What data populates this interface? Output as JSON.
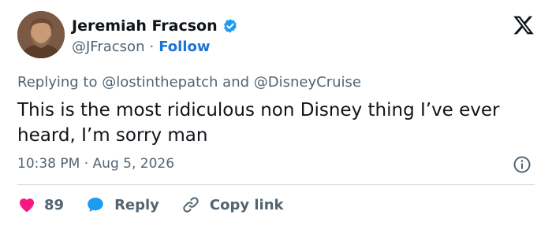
{
  "author": {
    "display_name": "Jeremiah Fracson",
    "handle": "@JFracson",
    "separator": "·",
    "follow_label": "Follow",
    "verified": true
  },
  "reply_context": {
    "prefix": "Replying to",
    "mention_1": "@lostinthepatch",
    "conjunction": "and",
    "mention_2": "@DisneyCruise"
  },
  "tweet": {
    "text": "This is the most ridiculous non Disney thing I’ve ever heard, I’m sorry man",
    "time": "10:38 PM",
    "separator": "·",
    "date": "Aug 5, 2026"
  },
  "actions": {
    "like_count": "89",
    "reply_label": "Reply",
    "copy_label": "Copy link"
  },
  "colors": {
    "like": "#f91880",
    "reply": "#1d9bf0",
    "follow": "#1d72d8",
    "verified": "#1d9bf0",
    "muted": "#536471"
  },
  "icons": {
    "logo": "x-logo-icon",
    "verified": "verified-badge-icon",
    "info": "info-icon",
    "like": "heart-icon",
    "reply": "speech-bubble-icon",
    "copy": "link-icon"
  }
}
